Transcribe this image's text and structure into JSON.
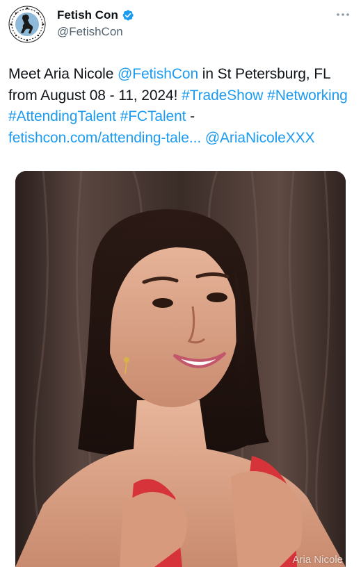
{
  "account": {
    "display_name": "Fetish Con",
    "handle": "@FetishCon",
    "verified": true,
    "avatar_icon": "fetishcon-logo-icon"
  },
  "tweet": {
    "segments": [
      {
        "text": "Meet Aria Nicole ",
        "type": "text"
      },
      {
        "text": "@FetishCon",
        "type": "mention"
      },
      {
        "text": " in St Petersburg, FL from August 08 - 11, 2024! ",
        "type": "text"
      },
      {
        "text": "#TradeShow",
        "type": "hashtag"
      },
      {
        "text": " ",
        "type": "text"
      },
      {
        "text": "#Networking",
        "type": "hashtag"
      },
      {
        "text": " ",
        "type": "text"
      },
      {
        "text": "#AttendingTalent",
        "type": "hashtag"
      },
      {
        "text": " ",
        "type": "text"
      },
      {
        "text": "#FCTalent",
        "type": "hashtag"
      },
      {
        "text": " - ",
        "type": "text"
      },
      {
        "text": "fetishcon.com/attending-tale...",
        "type": "url"
      },
      {
        "text": " ",
        "type": "text"
      },
      {
        "text": "@AriaNicoleXXX",
        "type": "mention"
      }
    ]
  },
  "media": {
    "watermark": "Aria Nicole"
  },
  "colors": {
    "link": "#1d9bf0",
    "verified": "#1d9bf0",
    "text": "#0f1419",
    "secondary": "#536471"
  },
  "icons": {
    "more": "more-horizontal-icon",
    "verified": "verified-badge-icon"
  }
}
